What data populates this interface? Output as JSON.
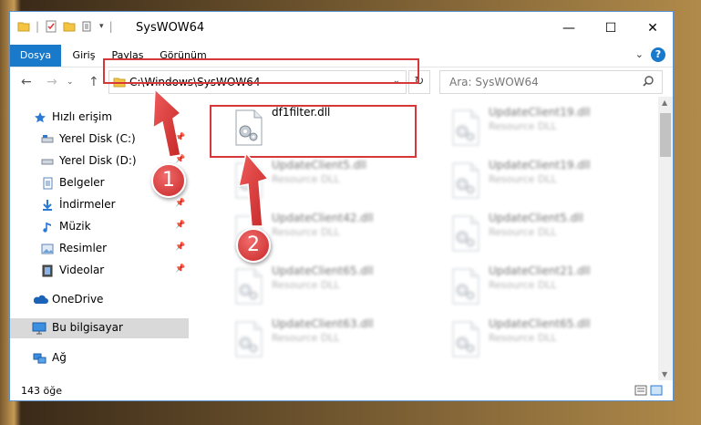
{
  "window": {
    "title": "SysWOW64",
    "controls": {
      "minimize": "—",
      "maximize": "☐",
      "close": "✕"
    }
  },
  "ribbon": {
    "tabs": [
      {
        "label": "Dosya",
        "active": true
      },
      {
        "label": "Giriş"
      },
      {
        "label": "Paylaş"
      },
      {
        "label": "Görünüm"
      }
    ],
    "help": "?"
  },
  "navigation": {
    "back": "←",
    "forward": "→",
    "up": "↑",
    "address": "C:\\Windows\\SysWOW64",
    "search_placeholder": "Ara: SysWOW64"
  },
  "sidebar": {
    "items": [
      {
        "label": "Hızlı erişim",
        "icon": "star-icon",
        "pinned": false
      },
      {
        "label": "Yerel Disk (C:)",
        "icon": "drive-icon",
        "pinned": true
      },
      {
        "label": "Yerel Disk (D:)",
        "icon": "drive-icon",
        "pinned": true
      },
      {
        "label": "Belgeler",
        "icon": "documents-icon",
        "pinned": true
      },
      {
        "label": "İndirmeler",
        "icon": "downloads-icon",
        "pinned": true
      },
      {
        "label": "Müzik",
        "icon": "music-icon",
        "pinned": true
      },
      {
        "label": "Resimler",
        "icon": "pictures-icon",
        "pinned": true
      },
      {
        "label": "Videolar",
        "icon": "videos-icon",
        "pinned": true
      },
      {
        "label": "OneDrive",
        "icon": "cloud-icon",
        "pinned": false
      },
      {
        "label": "Bu bilgisayar",
        "icon": "computer-icon",
        "pinned": false,
        "selected": true
      },
      {
        "label": "Ağ",
        "icon": "network-icon",
        "pinned": false
      }
    ]
  },
  "files": [
    {
      "name": "df1filter.dll",
      "type": "",
      "col": 0,
      "row": 0,
      "blurred": false
    },
    {
      "name": "UpdateClient19.dll",
      "type": "Resource DLL",
      "col": 1,
      "row": 0,
      "blurred": true
    },
    {
      "name": "UpdateClient5.dll",
      "type": "Resource DLL",
      "col": 0,
      "row": 1,
      "blurred": true
    },
    {
      "name": "UpdateClient19.dll",
      "type": "Resource DLL",
      "col": 1,
      "row": 1,
      "blurred": true
    },
    {
      "name": "UpdateClient42.dll",
      "type": "Resource DLL",
      "col": 0,
      "row": 2,
      "blurred": true
    },
    {
      "name": "UpdateClient5.dll",
      "type": "Resource DLL",
      "col": 1,
      "row": 2,
      "blurred": true
    },
    {
      "name": "UpdateClient65.dll",
      "type": "Resource DLL",
      "col": 0,
      "row": 3,
      "blurred": true
    },
    {
      "name": "UpdateClient21.dll",
      "type": "Resource DLL",
      "col": 1,
      "row": 3,
      "blurred": true
    },
    {
      "name": "UpdateClient63.dll",
      "type": "Resource DLL",
      "col": 0,
      "row": 4,
      "blurred": true
    },
    {
      "name": "UpdateClient65.dll",
      "type": "Resource DLL",
      "col": 1,
      "row": 4,
      "blurred": true
    }
  ],
  "status": {
    "item_count": "143 öğe"
  },
  "callouts": {
    "first": "1",
    "second": "2"
  },
  "colors": {
    "accent": "#1979ca",
    "highlight": "#d6383a"
  }
}
